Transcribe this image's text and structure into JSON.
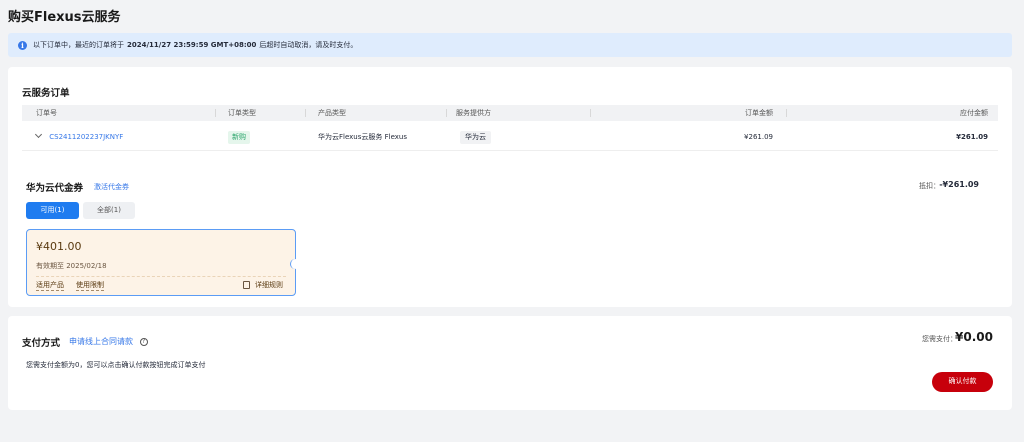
{
  "page": {
    "title": "购买Flexus云服务"
  },
  "notice": {
    "prefix": "以下订单中，最近的订单将于",
    "deadline": "2024/11/27 23:59:59 GMT+08:00",
    "suffix": "后超时自动取消，请及时支付。"
  },
  "orders": {
    "title": "云服务订单",
    "columns": [
      "订单号",
      "订单类型",
      "产品类型",
      "服务提供方",
      "订单金额",
      "应付金额"
    ],
    "rows": [
      {
        "order_no": "CS2411202237JKNYF",
        "order_type": "新购",
        "product_type": "华为云Flexus云服务 Flexus",
        "provider": "华为云",
        "order_amount": "¥261.09",
        "payable": "¥261.09"
      }
    ]
  },
  "voucher": {
    "title": "华为云代金券",
    "activate_link": "激活代金券",
    "deduct_label": "抵扣：",
    "deduct_value": "-¥261.09",
    "tabs": [
      {
        "label": "可用(1)",
        "active": true
      },
      {
        "label": "全部(1)",
        "active": false
      }
    ],
    "coupon": {
      "amount": "¥401.00",
      "expiry": "有效期至 2025/02/18",
      "applicable_link": "适用产品",
      "limit_link": "使用限制",
      "rules_link": "详细规则"
    }
  },
  "payment": {
    "title": "支付方式",
    "contract_link": "申请线上合同请款",
    "help_icon": "question-circle-icon",
    "due_label": "您需支付：",
    "due_value": "¥0.00",
    "hint": "您需支付金额为0，您可以点击确认付款按钮完成订单支付",
    "confirm_button": "确认付款"
  },
  "colors": {
    "accent": "#1f7cf0",
    "confirm": "#c7000b",
    "link": "#3778e8"
  }
}
